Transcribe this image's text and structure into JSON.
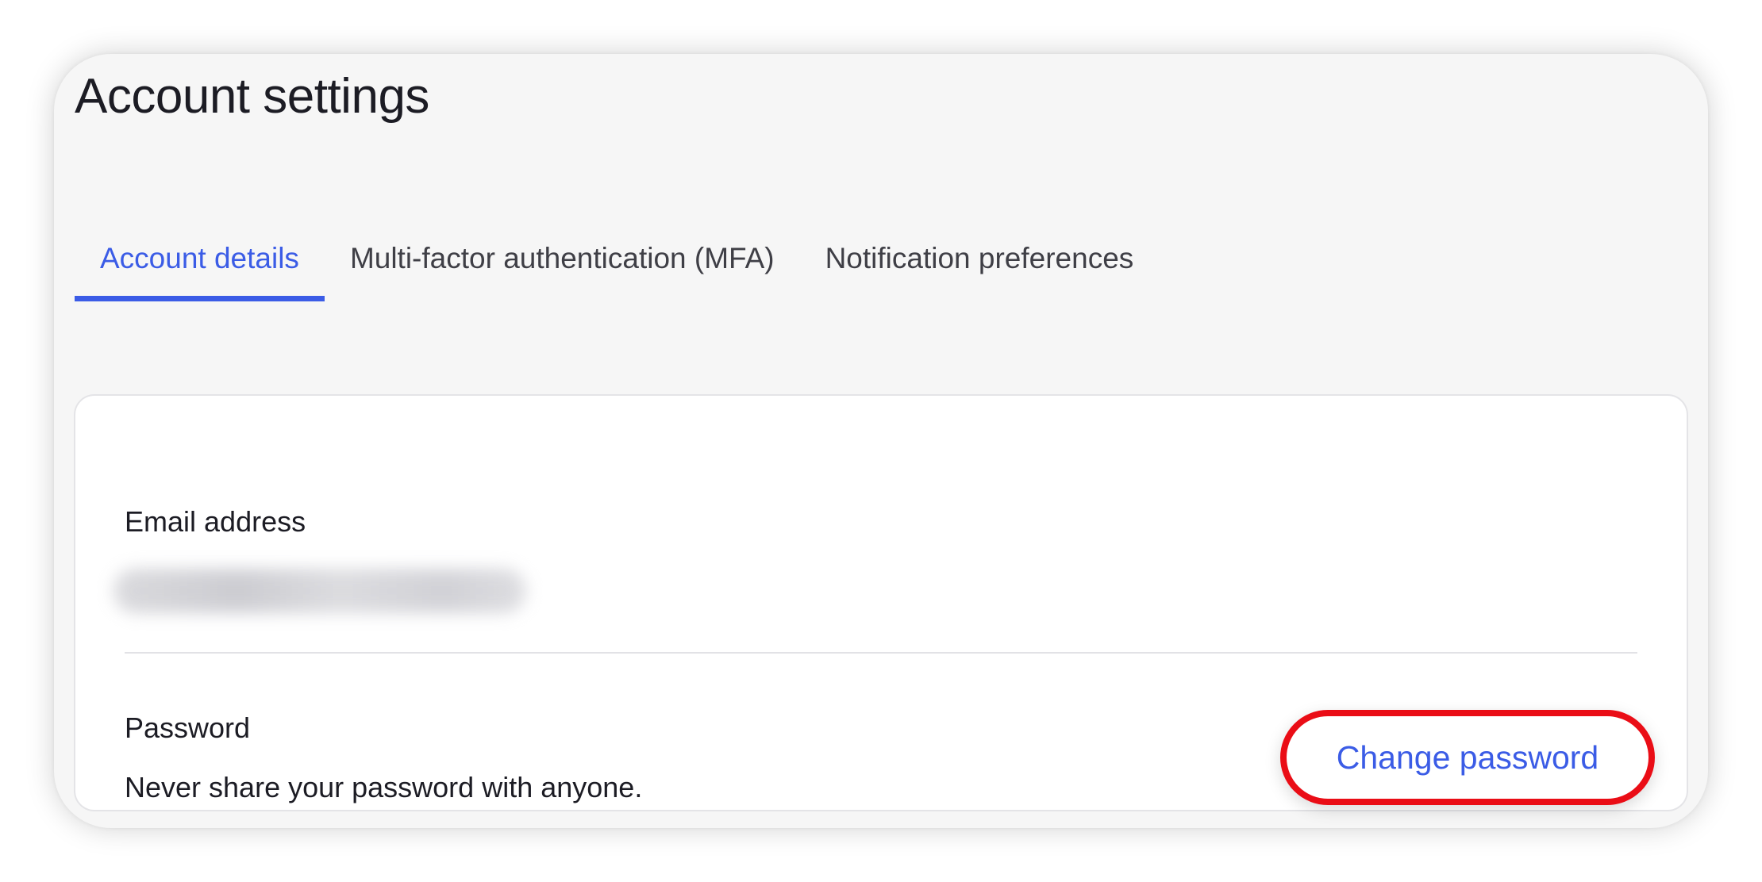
{
  "page": {
    "title": "Account settings"
  },
  "tabs": [
    {
      "label": "Account details",
      "active": true
    },
    {
      "label": "Multi-factor authentication (MFA)",
      "active": false
    },
    {
      "label": "Notification preferences",
      "active": false
    }
  ],
  "account": {
    "email": {
      "label": "Email address"
    },
    "password": {
      "label": "Password",
      "hint": "Never share your password with anyone.",
      "button_label": "Change password"
    }
  },
  "colors": {
    "accent": "#3b5ce6",
    "highlight_ring": "#ea0d16",
    "background": "#f6f6f6",
    "card": "#ffffff"
  }
}
